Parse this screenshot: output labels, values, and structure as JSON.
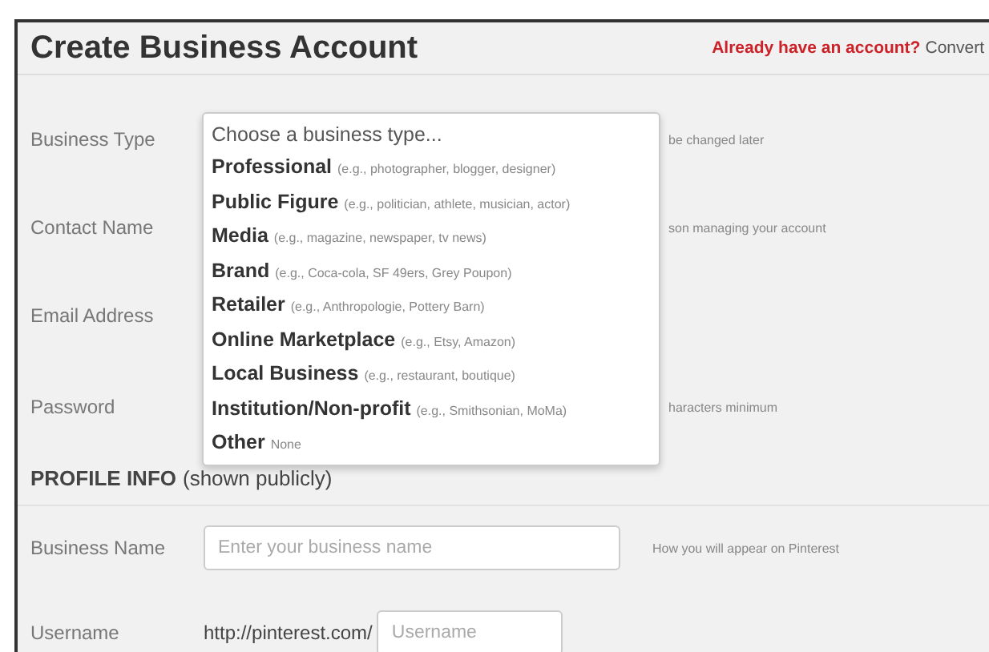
{
  "title": "Create Business Account",
  "account_link": {
    "question": "Already have an account?",
    "action": "Convert"
  },
  "fields": [
    {
      "label": "Business Type",
      "hint": "be changed later"
    },
    {
      "label": "Contact Name",
      "hint": "son managing your account"
    },
    {
      "label": "Email Address"
    },
    {
      "label": "Password",
      "hint": "haracters minimum"
    }
  ],
  "dropdown": {
    "prompt": "Choose a business type...",
    "options": [
      {
        "name": "Professional",
        "example": "(e.g., photographer, blogger, designer)"
      },
      {
        "name": "Public Figure",
        "example": "(e.g., politician, athlete, musician, actor)"
      },
      {
        "name": "Media",
        "example": "(e.g., magazine, newspaper, tv news)"
      },
      {
        "name": "Brand",
        "example": "(e.g., Coca-cola, SF 49ers, Grey Poupon)"
      },
      {
        "name": "Retailer",
        "example": "(e.g., Anthropologie, Pottery Barn)"
      },
      {
        "name": "Online Marketplace",
        "example": "(e.g., Etsy, Amazon)"
      },
      {
        "name": "Local Business",
        "example": "(e.g., restaurant, boutique)"
      },
      {
        "name": "Institution/Non-profit",
        "example": "(e.g., Smithsonian, MoMa)"
      },
      {
        "name": "Other",
        "example": "None"
      }
    ]
  },
  "profile": {
    "heading": "PROFILE INFO",
    "note": "(shown publicly)",
    "business_name": {
      "label": "Business Name",
      "placeholder": "Enter your business name",
      "hint": "How you will appear on Pinterest"
    },
    "username": {
      "label": "Username",
      "prefix": "http://pinterest.com/",
      "placeholder": "Username"
    }
  }
}
